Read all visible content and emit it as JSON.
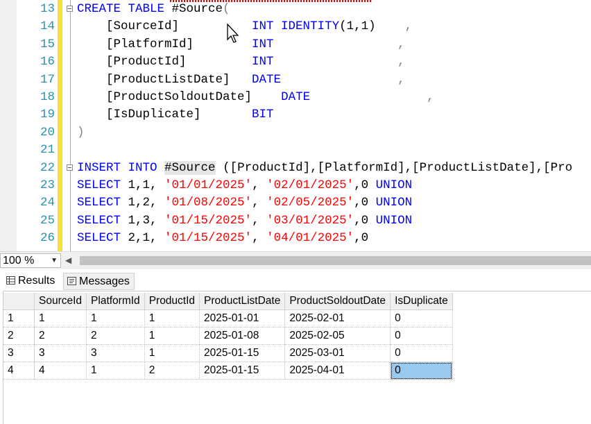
{
  "editor": {
    "lines": [
      {
        "num": "13",
        "tokens": [
          {
            "t": "CREATE TABLE",
            "c": "kw"
          },
          {
            "t": " #Source",
            "c": "txt"
          },
          {
            "t": "(",
            "c": "gray"
          }
        ]
      },
      {
        "num": "14",
        "tokens": [
          {
            "t": "    [SourceId]          ",
            "c": "txt"
          },
          {
            "t": "INT IDENTITY",
            "c": "kw"
          },
          {
            "t": "(1,1)",
            "c": "txt"
          },
          {
            "t": "    ,",
            "c": "gray"
          }
        ]
      },
      {
        "num": "15",
        "tokens": [
          {
            "t": "    [PlatformId]        ",
            "c": "txt"
          },
          {
            "t": "INT",
            "c": "kw"
          },
          {
            "t": "                 ,",
            "c": "gray"
          }
        ]
      },
      {
        "num": "16",
        "tokens": [
          {
            "t": "    [ProductId]         ",
            "c": "txt"
          },
          {
            "t": "INT",
            "c": "kw"
          },
          {
            "t": "                 ,",
            "c": "gray"
          }
        ]
      },
      {
        "num": "17",
        "tokens": [
          {
            "t": "    [ProductListDate]   ",
            "c": "txt"
          },
          {
            "t": "DATE",
            "c": "kw"
          },
          {
            "t": "                ,",
            "c": "gray"
          }
        ]
      },
      {
        "num": "18",
        "tokens": [
          {
            "t": "    [ProductSoldoutDate]    ",
            "c": "txt"
          },
          {
            "t": "DATE",
            "c": "kw"
          },
          {
            "t": "                ,",
            "c": "gray"
          }
        ]
      },
      {
        "num": "19",
        "tokens": [
          {
            "t": "    [IsDuplicate]       ",
            "c": "txt"
          },
          {
            "t": "BIT",
            "c": "kw"
          }
        ]
      },
      {
        "num": "20",
        "tokens": [
          {
            "t": ")",
            "c": "gray"
          }
        ]
      },
      {
        "num": "21",
        "tokens": []
      },
      {
        "num": "22",
        "tokens": [
          {
            "t": "INSERT INTO",
            "c": "kw"
          },
          {
            "t": " ",
            "c": "txt"
          },
          {
            "t": "#Source",
            "c": "hl"
          },
          {
            "t": " ([ProductId],[PlatformId],[ProductListDate],[Pro",
            "c": "txt"
          }
        ]
      },
      {
        "num": "23",
        "tokens": [
          {
            "t": "SELECT",
            "c": "kw"
          },
          {
            "t": " 1,1, ",
            "c": "txt"
          },
          {
            "t": "'01/01/2025'",
            "c": "str"
          },
          {
            "t": ", ",
            "c": "txt"
          },
          {
            "t": "'02/01/2025'",
            "c": "str"
          },
          {
            "t": ",0 ",
            "c": "txt"
          },
          {
            "t": "UNION",
            "c": "kw"
          }
        ]
      },
      {
        "num": "24",
        "tokens": [
          {
            "t": "SELECT",
            "c": "kw"
          },
          {
            "t": " 1,2, ",
            "c": "txt"
          },
          {
            "t": "'01/08/2025'",
            "c": "str"
          },
          {
            "t": ", ",
            "c": "txt"
          },
          {
            "t": "'02/05/2025'",
            "c": "str"
          },
          {
            "t": ",0 ",
            "c": "txt"
          },
          {
            "t": "UNION",
            "c": "kw"
          }
        ]
      },
      {
        "num": "25",
        "tokens": [
          {
            "t": "SELECT",
            "c": "kw"
          },
          {
            "t": " 1,3, ",
            "c": "txt"
          },
          {
            "t": "'01/15/2025'",
            "c": "str"
          },
          {
            "t": ", ",
            "c": "txt"
          },
          {
            "t": "'03/01/2025'",
            "c": "str"
          },
          {
            "t": ",0 ",
            "c": "txt"
          },
          {
            "t": "UNION",
            "c": "kw"
          }
        ]
      },
      {
        "num": "26",
        "tokens": [
          {
            "t": "SELECT",
            "c": "kw"
          },
          {
            "t": " 2,1, ",
            "c": "txt"
          },
          {
            "t": "'01/15/2025'",
            "c": "str"
          },
          {
            "t": ", ",
            "c": "txt"
          },
          {
            "t": "'04/01/2025'",
            "c": "str"
          },
          {
            "t": ",0",
            "c": "txt"
          }
        ]
      }
    ]
  },
  "zoom": {
    "value": "100 %"
  },
  "tabs": {
    "results": "Results",
    "messages": "Messages"
  },
  "grid": {
    "columns": [
      "SourceId",
      "PlatformId",
      "ProductId",
      "ProductListDate",
      "ProductSoldoutDate",
      "IsDuplicate"
    ],
    "rows": [
      {
        "num": "1",
        "cells": [
          "1",
          "1",
          "1",
          "2025-01-01",
          "2025-02-01",
          "0"
        ]
      },
      {
        "num": "2",
        "cells": [
          "2",
          "2",
          "1",
          "2025-01-08",
          "2025-02-05",
          "0"
        ]
      },
      {
        "num": "3",
        "cells": [
          "3",
          "3",
          "1",
          "2025-01-15",
          "2025-03-01",
          "0"
        ]
      },
      {
        "num": "4",
        "cells": [
          "4",
          "1",
          "2",
          "2025-01-15",
          "2025-04-01",
          "0"
        ]
      }
    ]
  },
  "colors": {
    "keyword": "#0000ff",
    "string": "#ff0000",
    "line_number": "#2b91af",
    "selection": "#99c9ef"
  }
}
